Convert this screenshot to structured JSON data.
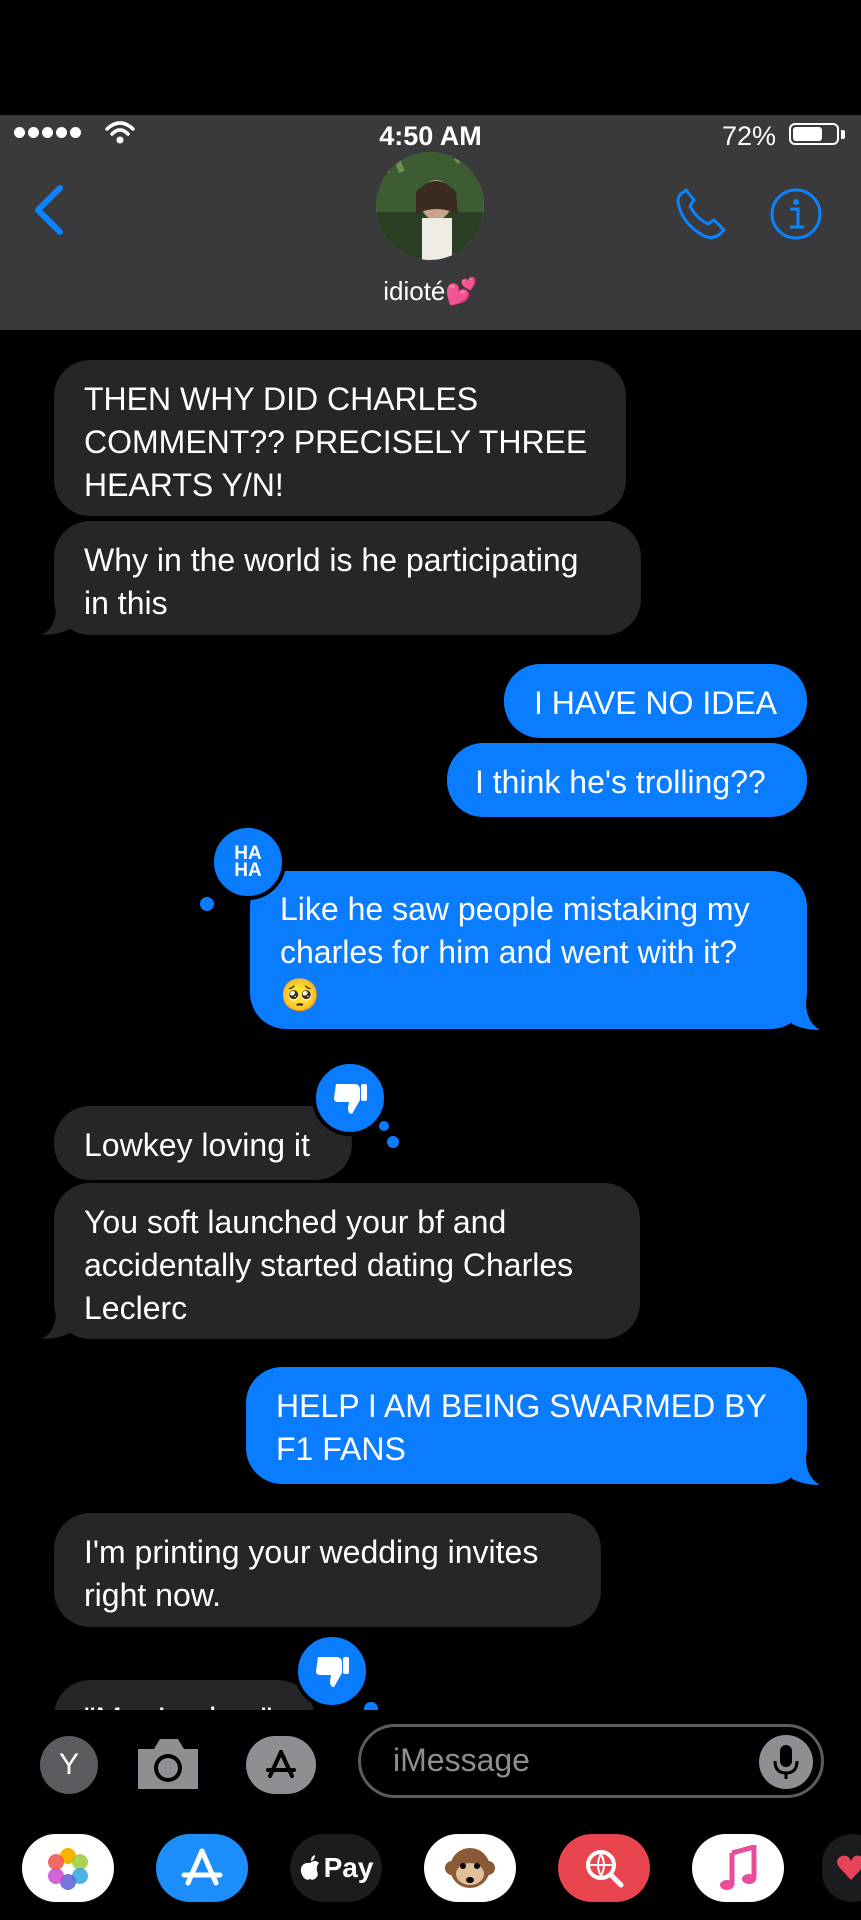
{
  "status_bar": {
    "time": "4:50 AM",
    "battery_percent": "72%",
    "battery_level": 0.72
  },
  "header": {
    "contact_name": "idioté💕",
    "back_icon": "chevron-left-icon",
    "call_icon": "phone-icon",
    "info_icon": "info-icon"
  },
  "messages": [
    {
      "direction": "incoming",
      "text": "THEN WHY DID CHARLES COMMENT?? PRECISELY THREE HEARTS Y/N!"
    },
    {
      "direction": "incoming",
      "text": "Why in the world is he participating in this"
    },
    {
      "direction": "outgoing",
      "text": "I HAVE NO IDEA"
    },
    {
      "direction": "outgoing",
      "text": "I think he's trolling??"
    },
    {
      "direction": "outgoing",
      "text": "Like he saw people mistaking my charles for him and went with it? 🥺",
      "tapback": "HA HA"
    },
    {
      "direction": "incoming",
      "text": "Lowkey loving it",
      "tapback": "thumbs-down"
    },
    {
      "direction": "incoming",
      "text": "You soft launched your bf and accidentally started dating Charles Leclerc"
    },
    {
      "direction": "outgoing",
      "text": "HELP I AM BEING SWARMED BY F1 FANS"
    },
    {
      "direction": "incoming",
      "text": "I'm printing your wedding invites right now."
    },
    {
      "direction": "incoming",
      "text": "\"Mrs Leclerc\"",
      "tapback": "thumbs-down"
    }
  ],
  "tapback_text": {
    "haha_line1": "HA",
    "haha_line2": "HA"
  },
  "input_bar": {
    "app_button_label": "Y",
    "placeholder": "iMessage"
  },
  "app_drawer": [
    "Photos",
    "App Store",
    "Apple Pay",
    "Animoji",
    "Images",
    "Music",
    "Heart"
  ],
  "apple_pay_label": "Pay",
  "colors": {
    "outgoing": "#0a7cff",
    "incoming": "#262628",
    "header": "#3a3a3c",
    "accent": "#0a84ff"
  }
}
